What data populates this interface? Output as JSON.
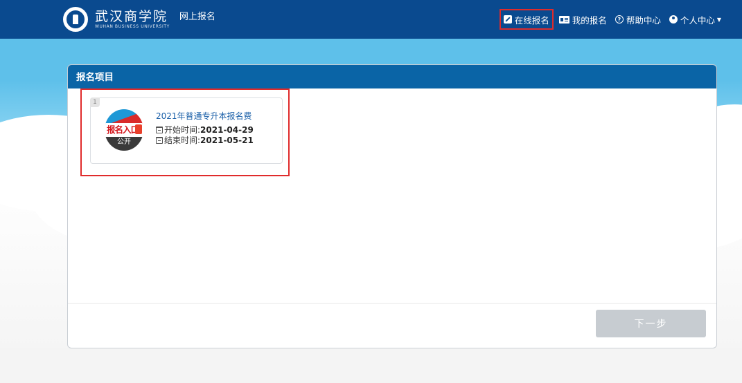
{
  "header": {
    "brand_cn": "武汉商学院",
    "brand_en": "WUHAN BUSINESS UNIVERSITY",
    "site_name": "网上报名",
    "nav": [
      {
        "label": "在线报名",
        "icon": "edit-icon",
        "active": true
      },
      {
        "label": "我的报名",
        "icon": "id-card-icon"
      },
      {
        "label": "帮助中心",
        "icon": "help-circle-icon"
      },
      {
        "label": "个人中心",
        "icon": "user-circle-icon",
        "dropdown": true
      }
    ]
  },
  "panel": {
    "title": "报名项目",
    "projects": [
      {
        "index": "1",
        "thumb_text": "报名入口",
        "thumb_sub": "公开",
        "title": "2021年普通专升本报名费",
        "start_label": "开始时间:",
        "start_date": "2021-04-29",
        "end_label": "结束时间:",
        "end_date": "2021-05-21"
      }
    ],
    "next_label": "下一步"
  },
  "colors": {
    "header_bg": "#0a4a8f",
    "panel_header_bg": "#0a64a6",
    "highlight": "#e02b2b",
    "button_disabled": "#c7ccd1"
  }
}
